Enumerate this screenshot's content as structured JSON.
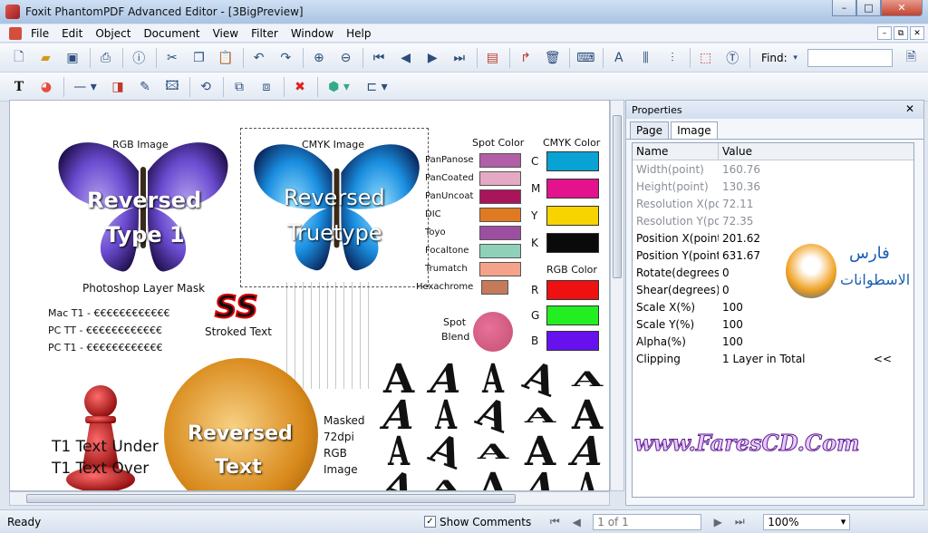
{
  "window": {
    "title": "Foxit PhantomPDF Advanced Editor - [3BigPreview]",
    "min_label": "–",
    "max_label": "□",
    "close_label": "✕"
  },
  "menu": {
    "items": [
      "File",
      "Edit",
      "Object",
      "Document",
      "View",
      "Filter",
      "Window",
      "Help"
    ],
    "mdi_buttons": [
      "–",
      "⧉",
      "✕"
    ]
  },
  "toolbar": {
    "find_label": "Find:",
    "find_value": ""
  },
  "canvas": {
    "rgb_image_label": "RGB Image",
    "reversed_type1": [
      "Reversed",
      "Type 1"
    ],
    "cmyk_image_label": "CMYK Image",
    "reversed_truetype": [
      "Reversed",
      "Truetype"
    ],
    "photoshop_label": "Photoshop Layer Mask",
    "mac_t1": "Mac T1 - €€€€€€€€€€€€",
    "pc_tt": "PC TT - €€€€€€€€€€€€",
    "pc_t1": "PC T1 - €€€€€€€€€€€€",
    "ss_text": "SS",
    "stroked_text": "Stroked Text",
    "spot_color_heading": "Spot Color",
    "spot_colors": [
      {
        "name": "PanPanose",
        "color": "#b05fa8"
      },
      {
        "name": "PanCoated",
        "color": "#e6a9c4"
      },
      {
        "name": "PanUncoat",
        "color": "#a8155a"
      },
      {
        "name": "DIC",
        "color": "#e07a22"
      },
      {
        "name": "Toyo",
        "color": "#9c4fa0"
      },
      {
        "name": "Focaltone",
        "color": "#8fd1b8"
      },
      {
        "name": "Trumatch",
        "color": "#f4a38a"
      },
      {
        "name": "Hexachrome",
        "color": "#c57a5a"
      }
    ],
    "cmyk_heading": "CMYK Color",
    "cmyk_colors": [
      {
        "name": "C",
        "color": "#08a3d4"
      },
      {
        "name": "M",
        "color": "#e3138e"
      },
      {
        "name": "Y",
        "color": "#f7d400"
      },
      {
        "name": "K",
        "color": "#0a0a0a"
      }
    ],
    "rgb_heading": "RGB Color",
    "rgb_colors": [
      {
        "name": "R",
        "color": "#ee1111"
      },
      {
        "name": "G",
        "color": "#22ee22"
      },
      {
        "name": "B",
        "color": "#6611ee"
      }
    ],
    "spot_blend": [
      "Spot",
      "Blend"
    ],
    "t1_under": "T1 Text Under",
    "t1_over": "T1 Text Over",
    "reversed_text": [
      "Reversed",
      "Text"
    ],
    "masked_label": [
      "Masked",
      "72dpi",
      "RGB",
      "Image"
    ],
    "glyph": "A",
    "watermark": "www.FaresCD.Com",
    "logo_text": [
      "فارس",
      "الاسطوانات"
    ]
  },
  "properties": {
    "title": "Properties",
    "close_label": "✕",
    "tabs": [
      "Page",
      "Image"
    ],
    "active_tab": "Image",
    "columns": [
      "Name",
      "Value"
    ],
    "rows": [
      {
        "name": "Width(point)",
        "value": "160.76",
        "disabled": true
      },
      {
        "name": "Height(point)",
        "value": "130.36",
        "disabled": true
      },
      {
        "name": "Resolution X(point)",
        "value": "72.11",
        "disabled": true
      },
      {
        "name": "Resolution Y(point)",
        "value": "72.35",
        "disabled": true
      },
      {
        "name": "Position X(points)",
        "value": "201.62",
        "disabled": false
      },
      {
        "name": "Position Y(points)",
        "value": "631.67",
        "disabled": false
      },
      {
        "name": "Rotate(degrees)",
        "value": "0",
        "disabled": false
      },
      {
        "name": "Shear(degrees)",
        "value": "0",
        "disabled": false
      },
      {
        "name": "Scale X(%)",
        "value": "100",
        "disabled": false
      },
      {
        "name": "Scale Y(%)",
        "value": "100",
        "disabled": false
      },
      {
        "name": "Alpha(%)",
        "value": "100",
        "disabled": false
      },
      {
        "name": "Clipping",
        "value": "1 Layer in Total",
        "disabled": false
      }
    ],
    "clipping_expand": "<<"
  },
  "status": {
    "ready": "Ready",
    "show_comments": "Show Comments",
    "page_indicator": "1 of 1",
    "zoom": "100%"
  }
}
